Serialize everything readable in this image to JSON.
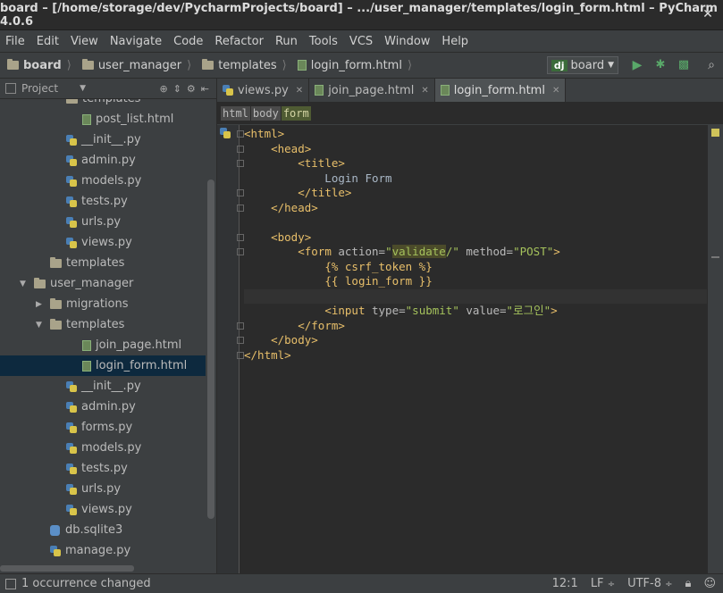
{
  "window": {
    "title": "board – [/home/storage/dev/PycharmProjects/board] – .../user_manager/templates/login_form.html – PyCharm 4.0.6"
  },
  "menu": [
    "File",
    "Edit",
    "View",
    "Navigate",
    "Code",
    "Refactor",
    "Run",
    "Tools",
    "VCS",
    "Window",
    "Help"
  ],
  "breadcrumbs": [
    "board",
    "user_manager",
    "templates",
    "login_form.html"
  ],
  "run_config": {
    "label": "board",
    "badge": "dj"
  },
  "project_panel": {
    "title": "Project"
  },
  "tree": [
    {
      "label": "templates",
      "kind": "folder",
      "indent": 3,
      "arrow": ""
    },
    {
      "label": "post_list.html",
      "kind": "html",
      "indent": 4,
      "arrow": ""
    },
    {
      "label": "__init__.py",
      "kind": "py",
      "indent": 3,
      "arrow": ""
    },
    {
      "label": "admin.py",
      "kind": "py",
      "indent": 3,
      "arrow": ""
    },
    {
      "label": "models.py",
      "kind": "py",
      "indent": 3,
      "arrow": ""
    },
    {
      "label": "tests.py",
      "kind": "py",
      "indent": 3,
      "arrow": ""
    },
    {
      "label": "urls.py",
      "kind": "py",
      "indent": 3,
      "arrow": ""
    },
    {
      "label": "views.py",
      "kind": "py",
      "indent": 3,
      "arrow": ""
    },
    {
      "label": "templates",
      "kind": "folder",
      "indent": 2,
      "arrow": ""
    },
    {
      "label": "user_manager",
      "kind": "folder",
      "indent": 1,
      "arrow": "▼"
    },
    {
      "label": "migrations",
      "kind": "folder",
      "indent": 2,
      "arrow": "▶"
    },
    {
      "label": "templates",
      "kind": "folder",
      "indent": 2,
      "arrow": "▼"
    },
    {
      "label": "join_page.html",
      "kind": "html",
      "indent": 4,
      "arrow": ""
    },
    {
      "label": "login_form.html",
      "kind": "html",
      "indent": 4,
      "arrow": "",
      "selected": true
    },
    {
      "label": "__init__.py",
      "kind": "py",
      "indent": 3,
      "arrow": ""
    },
    {
      "label": "admin.py",
      "kind": "py",
      "indent": 3,
      "arrow": ""
    },
    {
      "label": "forms.py",
      "kind": "py",
      "indent": 3,
      "arrow": ""
    },
    {
      "label": "models.py",
      "kind": "py",
      "indent": 3,
      "arrow": ""
    },
    {
      "label": "tests.py",
      "kind": "py",
      "indent": 3,
      "arrow": ""
    },
    {
      "label": "urls.py",
      "kind": "py",
      "indent": 3,
      "arrow": ""
    },
    {
      "label": "views.py",
      "kind": "py",
      "indent": 3,
      "arrow": ""
    },
    {
      "label": "db.sqlite3",
      "kind": "db",
      "indent": 2,
      "arrow": ""
    },
    {
      "label": "manage.py",
      "kind": "py",
      "indent": 2,
      "arrow": ""
    }
  ],
  "tabs": [
    {
      "label": "views.py",
      "kind": "py",
      "active": false
    },
    {
      "label": "join_page.html",
      "kind": "html",
      "active": false
    },
    {
      "label": "login_form.html",
      "kind": "html",
      "active": true
    }
  ],
  "tag_breadcrumbs": [
    "html",
    "body",
    "form"
  ],
  "code_lines": [
    [
      [
        "<html>",
        "tag"
      ]
    ],
    [
      [
        "    ",
        "text"
      ],
      [
        "<head>",
        "tag"
      ]
    ],
    [
      [
        "        ",
        "text"
      ],
      [
        "<title>",
        "tag"
      ]
    ],
    [
      [
        "            Login Form",
        "text"
      ]
    ],
    [
      [
        "        ",
        "text"
      ],
      [
        "</title>",
        "tag"
      ]
    ],
    [
      [
        "    ",
        "text"
      ],
      [
        "</head>",
        "tag"
      ]
    ],
    [
      [
        "",
        "text"
      ]
    ],
    [
      [
        "    ",
        "text"
      ],
      [
        "<body>",
        "tag"
      ]
    ],
    [
      [
        "        ",
        "text"
      ],
      [
        "<form ",
        "tag"
      ],
      [
        "action=",
        "attr"
      ],
      [
        "\"",
        "val"
      ],
      [
        "validate",
        "hl"
      ],
      [
        "/\"",
        "val"
      ],
      [
        " method=",
        "attr"
      ],
      [
        "\"POST\"",
        "val"
      ],
      [
        ">",
        "tag"
      ]
    ],
    [
      [
        "            ",
        "text"
      ],
      [
        "{% csrf_token %}",
        "tpl"
      ]
    ],
    [
      [
        "            ",
        "text"
      ],
      [
        "{{ login_form }}",
        "tpl"
      ]
    ],
    [
      [
        "",
        "text"
      ]
    ],
    [
      [
        "            ",
        "text"
      ],
      [
        "<input ",
        "tag"
      ],
      [
        "type=",
        "attr"
      ],
      [
        "\"submit\"",
        "val"
      ],
      [
        " value=",
        "attr"
      ],
      [
        "\"로그인\"",
        "val"
      ],
      [
        ">",
        "tag"
      ]
    ],
    [
      [
        "        ",
        "text"
      ],
      [
        "</form>",
        "tag"
      ]
    ],
    [
      [
        "    ",
        "text"
      ],
      [
        "</body>",
        "tag"
      ]
    ],
    [
      [
        "</html>",
        "tag"
      ]
    ]
  ],
  "current_line_index": 11,
  "status": {
    "message": "1 occurrence changed",
    "position": "12:1",
    "line_sep": "LF",
    "encoding": "UTF-8"
  },
  "colors": {
    "tag": "#e8bf6a",
    "attr": "#bababa",
    "val": "#a5c25c",
    "tpl": "#e8bf6a",
    "text": "#a9b7c6",
    "selection": "#0d293e"
  }
}
